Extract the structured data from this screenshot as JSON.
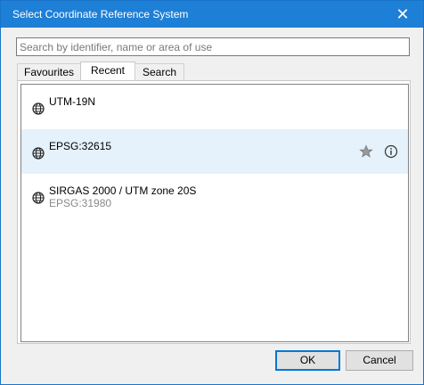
{
  "window": {
    "title": "Select Coordinate Reference System",
    "close_glyph": "✕"
  },
  "search": {
    "placeholder": "Search by identifier, name or area of use",
    "value": ""
  },
  "tabs": [
    {
      "label": "Favourites",
      "active": false
    },
    {
      "label": "Recent",
      "active": true
    },
    {
      "label": "Search",
      "active": false
    }
  ],
  "list": {
    "items": [
      {
        "name": "UTM-19N",
        "code": "",
        "icon": "globe-icon",
        "selected": false
      },
      {
        "name": "EPSG:32615",
        "code": "",
        "icon": "globe-icon",
        "selected": true,
        "actions": [
          "star-icon",
          "info-icon"
        ]
      },
      {
        "name": "SIRGAS 2000 / UTM zone 20S",
        "code": "EPSG:31980",
        "icon": "globe-icon",
        "selected": false
      }
    ]
  },
  "buttons": {
    "ok_label": "OK",
    "cancel_label": "Cancel"
  },
  "colors": {
    "titlebar": "#1e7fd6",
    "selection": "#e5f1fb",
    "default_button_border": "#0078d7"
  }
}
